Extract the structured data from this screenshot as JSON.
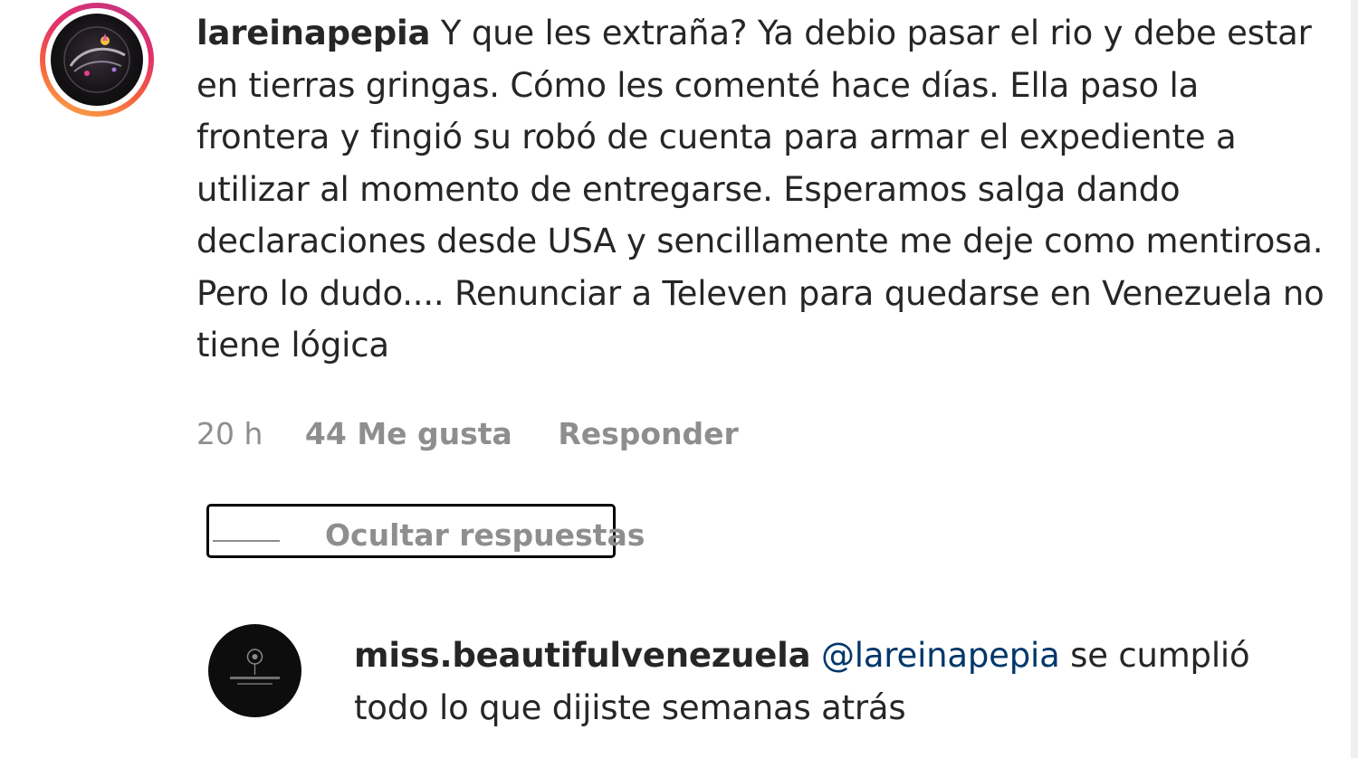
{
  "comment": {
    "username": "lareinapepia",
    "text": "Y que les extraña? Ya debio pasar el rio y debe estar en tierras gringas. Cómo les comenté hace días. Ella paso la frontera y fingió su robó de cuenta para armar el expediente a utilizar al momento de entregarse. Esperamos salga dando declaraciones desde USA y sencillamente me deje como mentirosa. Pero lo dudo.... Renunciar a Televen para quedarse en Venezuela no tiene lógica",
    "time": "20 h",
    "likes": "44 Me gusta",
    "reply_label": "Responder"
  },
  "hide_replies": {
    "label": "Ocultar respuestas"
  },
  "reply": {
    "username": "miss.beautifulvenezuela",
    "mention": "@lareinapepia",
    "text": "se cumplió todo lo que dijiste semanas atrás"
  },
  "colors": {
    "text": "#262626",
    "secondary": "#8e8e8e",
    "mention": "#00376b",
    "story_ring_start": "#c13584",
    "story_ring_end": "#fcaf45"
  }
}
